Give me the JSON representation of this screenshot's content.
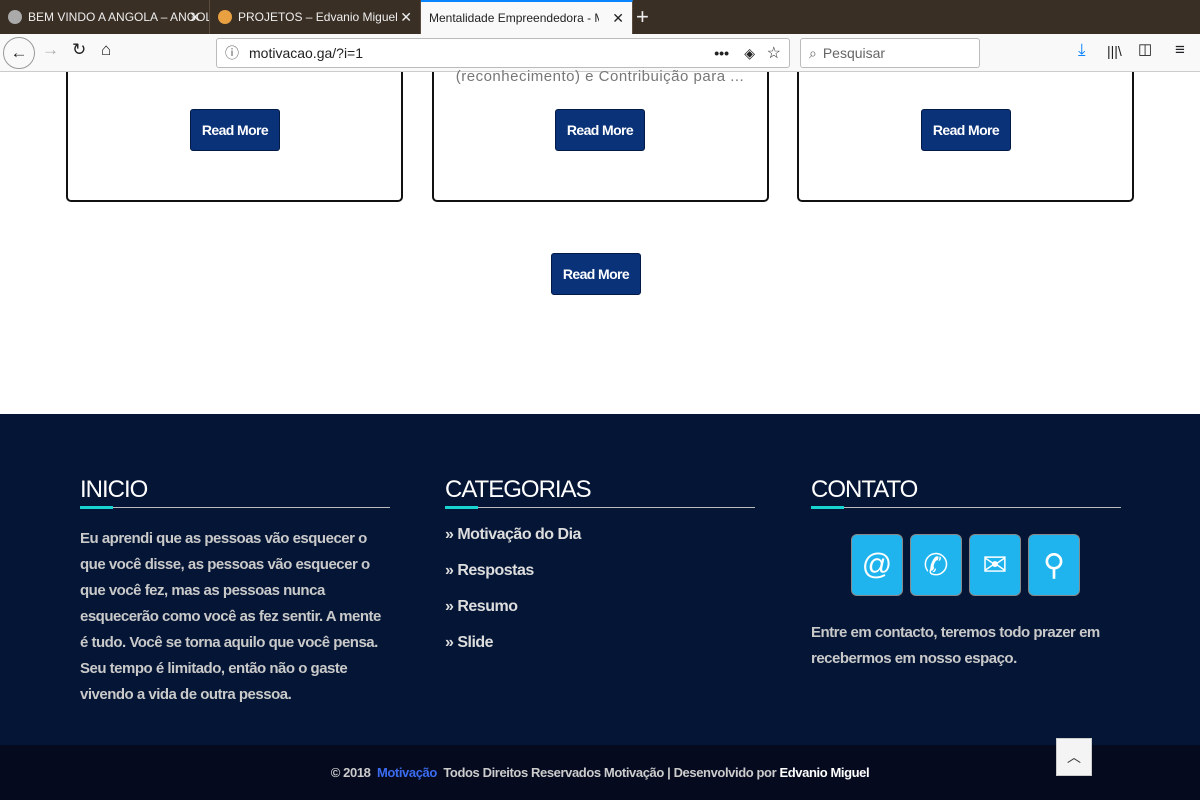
{
  "browser": {
    "tabs": [
      {
        "title": "BEM VINDO A ANGOLA – ANGOLA",
        "favicon_color": "#aaaaaa"
      },
      {
        "title": "PROJETOS – Edvanio Miguel",
        "favicon_color": "#e8a040"
      },
      {
        "title": "Mentalidade Empreendedora - Motivação",
        "active": true
      }
    ],
    "url": "motivacao.ga/?i=1",
    "search_placeholder": "Pesquisar",
    "more": "•••"
  },
  "content": {
    "excerpt": "(reconhecimento) e Contribuição para ...",
    "card_buttons": [
      "Read More",
      "Read More",
      "Read More"
    ],
    "main_button": "Read More"
  },
  "footer": {
    "inicio": {
      "title": "INICIO",
      "text": "Eu aprendi que as pessoas vão esquecer o que você disse, as pessoas vão esquecer o que você fez, mas as pessoas nunca esquecerão como você as fez sentir. A mente é tudo. Você se torna aquilo que você pensa. Seu tempo é limitado, então não o gaste vivendo a vida de outra pessoa."
    },
    "categorias": {
      "title": "CATEGORIAS",
      "items": [
        "Motivação do Dia",
        "Respostas",
        "Resumo",
        "Slide"
      ]
    },
    "contato": {
      "title": "CONTATO",
      "icons": [
        "at-icon",
        "phone-icon",
        "envelope-icon",
        "map-pin-icon"
      ],
      "text": "Entre em contacto, teremos todo prazer em recebermos em nosso espaço."
    },
    "copyright": {
      "prefix": "© 2018",
      "brand": "Motivação",
      "middle": "Todos  Direitos  Reservados  Motivação | Desenvolvido por",
      "author": "Edvanio Miguel"
    },
    "brand_color": "#3b6cf0",
    "accent_color": "#17d4d0"
  }
}
